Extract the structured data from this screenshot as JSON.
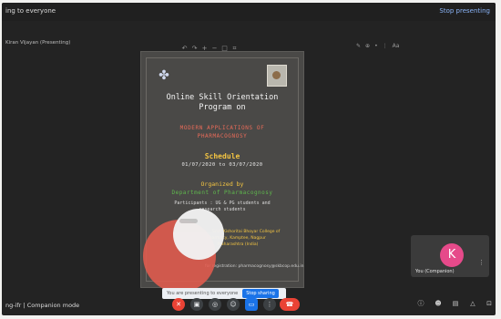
{
  "topbar": {
    "left_text": "ing to everyone",
    "right_text": "Stop presenting"
  },
  "presenter_label": "Kiran Vijayan (Presenting)",
  "slide_toolbar": {
    "icons": [
      "undo-icon",
      "redo-icon",
      "zoom-in-icon",
      "zoom-out-icon",
      "fit-icon",
      "crop-icon"
    ]
  },
  "view_toolbar": {
    "icons": [
      "pencil-icon",
      "zoom-icon",
      "pin-icon",
      "more-icon"
    ],
    "layout_label": "Aa"
  },
  "poster": {
    "title_line1": "Online Skill Orientation",
    "title_line2": "Program on",
    "subtitle_line1": "MODERN APPLICATIONS OF",
    "subtitle_line2": "PHARMACOGNOSY",
    "schedule_label": "Schedule",
    "dates": "01/07/2020 to 03/07/2020",
    "organized_label": "Organized by",
    "org_name": "Department of Pharmacognosy",
    "line1": "Participants : UG & PG students and",
    "line2": "research students",
    "line3": "Smt. Kishoritai Bhoyar College of",
    "line4": "Pharmacy, Kamptee, Nagpur",
    "line5": "Maharashtra (India)",
    "email": "for registration: pharmacognosy@skbcop.edu.in"
  },
  "participant": {
    "avatar_letter": "K",
    "name": "You (Companion)"
  },
  "bottom_left": {
    "meeting": "ng-ifr",
    "mode": "Companion mode"
  },
  "share_banner": {
    "message": "You are presenting to everyone",
    "stop_label": "Stop sharing"
  },
  "controls": {
    "hangup_icon": "phone-hangup-icon"
  },
  "colors": {
    "background": "#232323",
    "accent": "#1a73e8",
    "danger": "#ea4335",
    "avatar": "#e64a8a",
    "schedule": "#f4c542",
    "subtitle": "#e86b59",
    "org": "#5fb84d"
  }
}
